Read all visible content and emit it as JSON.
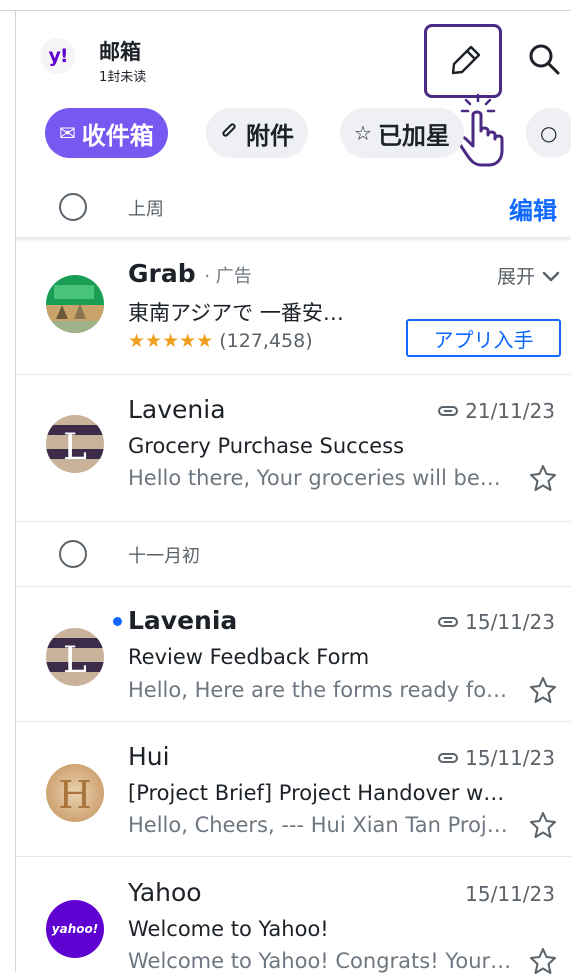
{
  "header": {
    "logo_text": "y!",
    "title": "邮箱",
    "unread": "1封未读",
    "compose_icon": "pencil-icon",
    "search_icon": "search-icon"
  },
  "chips": [
    {
      "label": "收件箱",
      "icon": "✉",
      "active": true
    },
    {
      "label": "附件",
      "icon": "📎",
      "active": false
    },
    {
      "label": "已加星",
      "icon": "☆",
      "active": false
    },
    {
      "label": "",
      "icon": "○",
      "active": false
    }
  ],
  "sections": {
    "last_week": "上周",
    "early_nov": "十一月初",
    "edit": "编辑"
  },
  "ad": {
    "sender": "Grab",
    "tag": "· 广告",
    "expand": "展开",
    "subject": "東南アジアで 一番安…",
    "stars": "★★★★★",
    "rating_count": "(127,458)",
    "cta": "アプリ入手"
  },
  "emails": [
    {
      "sender": "Lavenia",
      "date": "21/11/23",
      "subject": "Grocery Purchase Success",
      "snippet": "Hello there, Your groceries will be…",
      "unread": false,
      "attachment": true
    },
    {
      "sender": "Lavenia",
      "date": "15/11/23",
      "subject": "Review Feedback Form",
      "snippet": "Hello, Here are the forms ready fo…",
      "unread": true,
      "attachment": true
    },
    {
      "sender": "Hui",
      "date": "15/11/23",
      "subject": "[Project Brief] Project Handover w…",
      "snippet": "Hello, Cheers, --- Hui Xian Tan Proj…",
      "unread": false,
      "attachment": true
    },
    {
      "sender": "Yahoo",
      "date": "15/11/23",
      "subject": "Welcome to Yahoo!",
      "snippet": "Welcome to Yahoo! Congrats! Your…",
      "unread": false,
      "attachment": false,
      "avatar_text": "yahoo!"
    }
  ],
  "colors": {
    "accent": "#7759f2",
    "link": "#0f69ff",
    "yahoo_purple": "#5f01d1",
    "star": "#f0a020"
  }
}
